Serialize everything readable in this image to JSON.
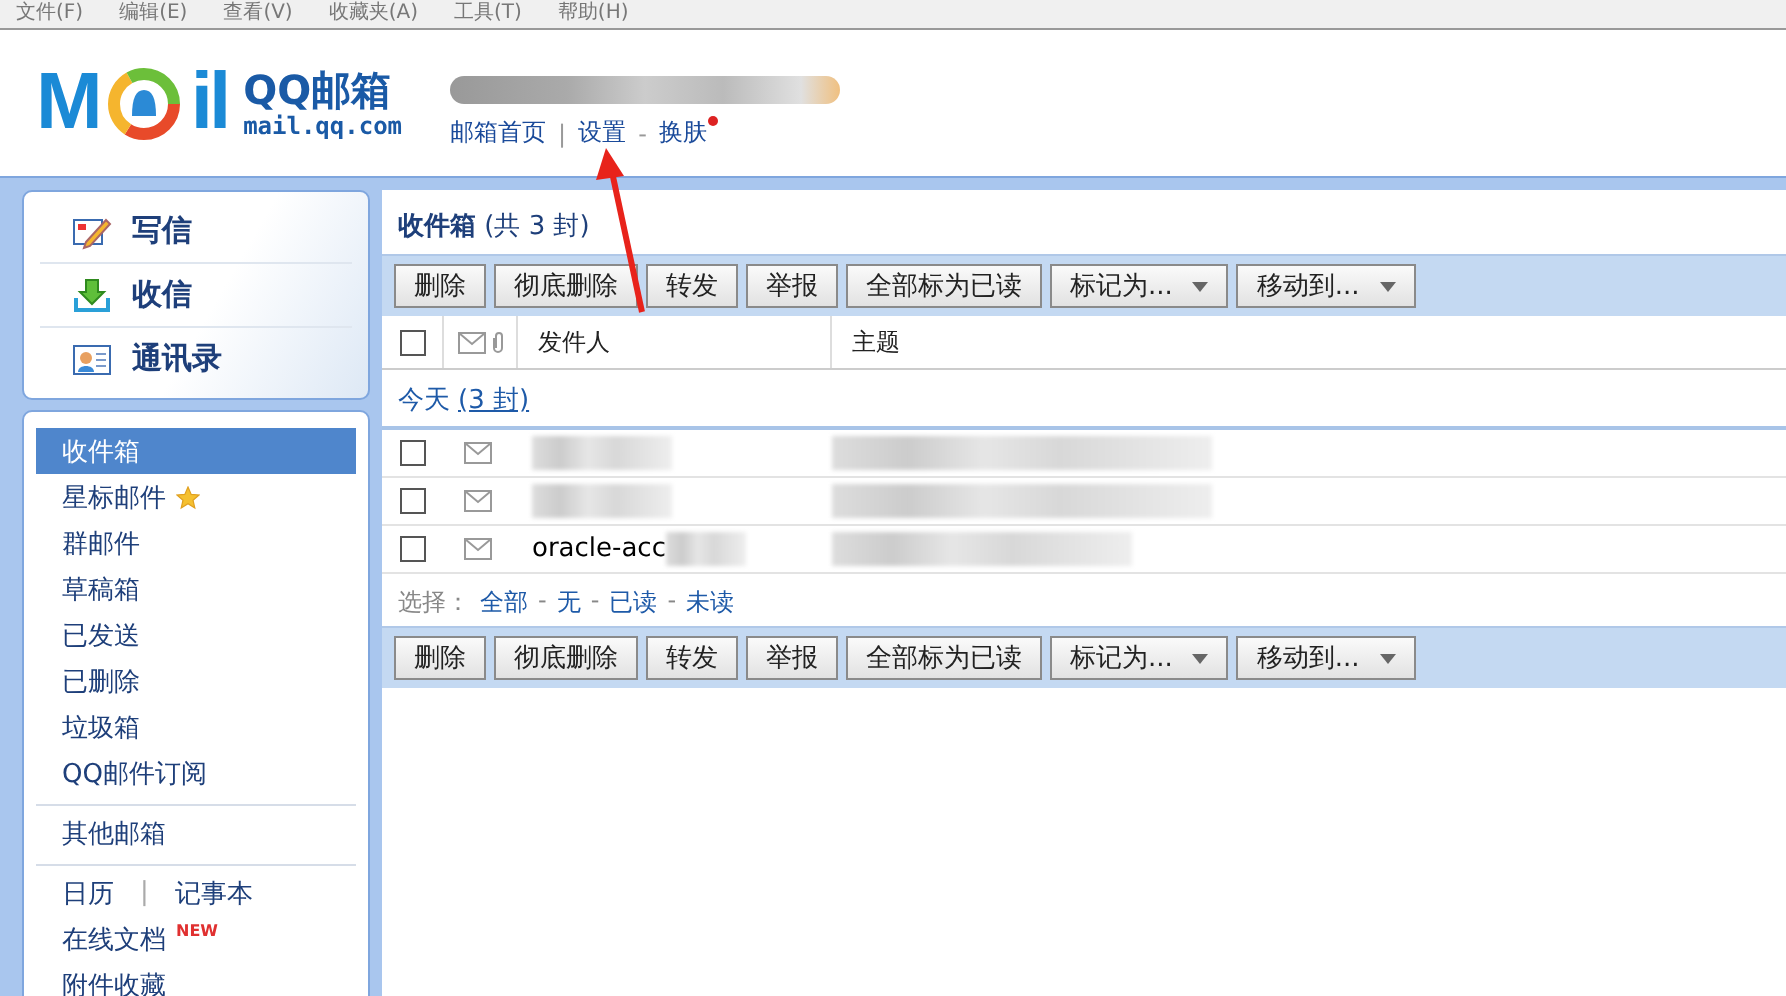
{
  "menu_bar": [
    "文件(F)",
    "编辑(E)",
    "查看(V)",
    "收藏夹(A)",
    "工具(T)",
    "帮助(H)"
  ],
  "logo": {
    "left": "M",
    "right": "il",
    "name": "QQ邮箱",
    "domain": "mail.qq.com"
  },
  "header_links": [
    {
      "label": "邮箱首页",
      "dot": false
    },
    {
      "label": "设置",
      "dot": false
    },
    {
      "label": "换肤",
      "dot": true
    }
  ],
  "header_separators": [
    "|",
    "-"
  ],
  "sidebar": {
    "actions": [
      {
        "label": "写信",
        "kind": "compose"
      },
      {
        "label": "收信",
        "kind": "receive"
      },
      {
        "label": "通讯录",
        "kind": "contacts"
      }
    ],
    "folder_groups": [
      [
        {
          "label": "收件箱",
          "kind": "plain",
          "selected": true
        },
        {
          "label": "星标邮件",
          "kind": "star",
          "selected": false
        },
        {
          "label": "群邮件",
          "kind": "plain",
          "selected": false
        },
        {
          "label": "草稿箱",
          "kind": "plain",
          "selected": false
        },
        {
          "label": "已发送",
          "kind": "plain",
          "selected": false
        },
        {
          "label": "已删除",
          "kind": "plain",
          "selected": false
        },
        {
          "label": "垃圾箱",
          "kind": "plain",
          "selected": false
        },
        {
          "label": "QQ邮件订阅",
          "kind": "plain",
          "selected": false
        }
      ],
      [
        {
          "label": "其他邮箱",
          "kind": "plain",
          "selected": false
        }
      ],
      [
        {
          "label": "日历",
          "separator": "|",
          "label_2": "记事本",
          "kind": "pair",
          "selected": false
        },
        {
          "label": "在线文档",
          "badge": "NEW",
          "kind": "new",
          "selected": false
        },
        {
          "label": "附件收藏",
          "kind": "plain",
          "selected": false
        }
      ]
    ]
  },
  "mailbox": {
    "title": "收件箱",
    "subtitle": "(共 3 封)",
    "toolbar_top": [
      {
        "label": "删除",
        "kind": "plain"
      },
      {
        "label": "彻底删除",
        "kind": "plain"
      },
      {
        "label": "转发",
        "kind": "plain"
      },
      {
        "label": "举报",
        "kind": "plain"
      },
      {
        "label": "全部标为已读",
        "kind": "plain"
      },
      {
        "label": "标记为...",
        "kind": "dropdown"
      },
      {
        "label": "移动到...",
        "kind": "dropdown"
      }
    ],
    "header_checkbox": {
      "checked": false
    },
    "columns": [
      "发件人",
      "主题"
    ],
    "group": {
      "label": "今天",
      "count": "(3 封)"
    },
    "rows": [
      {
        "sender": "",
        "checked": false
      },
      {
        "sender": "",
        "checked": false
      },
      {
        "sender": "oracle-acc",
        "checked": false
      }
    ],
    "select": {
      "label": "选择：",
      "options": [
        "全部",
        "无",
        "已读",
        "未读"
      ],
      "separator": "-"
    },
    "toolbar_bottom": [
      {
        "label": "删除",
        "kind": "plain"
      },
      {
        "label": "彻底删除",
        "kind": "plain"
      },
      {
        "label": "转发",
        "kind": "plain"
      },
      {
        "label": "举报",
        "kind": "plain"
      },
      {
        "label": "全部标为已读",
        "kind": "plain"
      },
      {
        "label": "标记为...",
        "kind": "dropdown"
      },
      {
        "label": "移动到...",
        "kind": "dropdown"
      }
    ]
  }
}
